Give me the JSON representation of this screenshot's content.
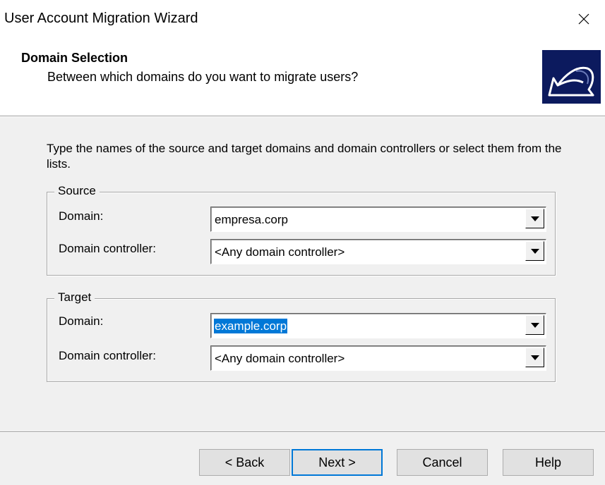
{
  "window": {
    "title": "User Account Migration Wizard",
    "close_icon": "close-icon"
  },
  "header": {
    "title": "Domain Selection",
    "subtitle": "Between which domains do you want to migrate users?",
    "icon": "wizard-arrow-icon"
  },
  "instructions": "Type the names of the source and target domains and domain controllers or select them from the lists.",
  "source": {
    "legend": "Source",
    "domain_label": "Domain:",
    "domain_value": "empresa.corp",
    "dc_label": "Domain controller:",
    "dc_value": "<Any domain controller>"
  },
  "target": {
    "legend": "Target",
    "domain_label": "Domain:",
    "domain_value": "example.corp",
    "dc_label": "Domain controller:",
    "dc_value": "<Any domain controller>"
  },
  "buttons": {
    "back": "< Back",
    "next": "Next >",
    "cancel": "Cancel",
    "help": "Help"
  },
  "colors": {
    "selection": "#0078d7",
    "icon_background": "#0c1a5e",
    "dialog_background": "#f0f0f0"
  }
}
